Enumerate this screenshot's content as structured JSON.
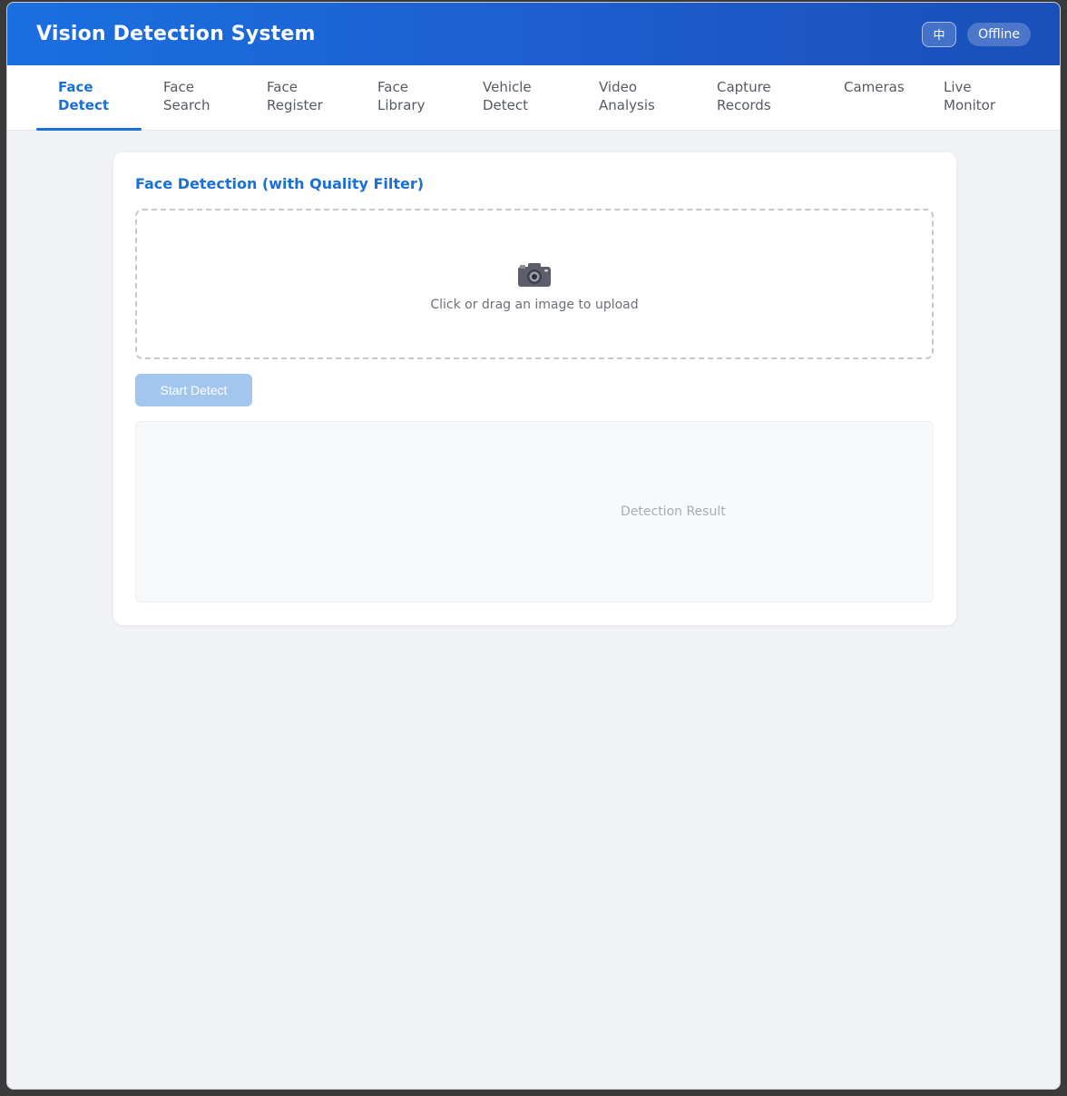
{
  "header": {
    "title": "Vision Detection System",
    "lang_button": "中",
    "status": "Offline"
  },
  "nav": {
    "tabs": [
      {
        "line1": "Face",
        "line2": "Detect",
        "active": true
      },
      {
        "line1": "Face",
        "line2": "Search",
        "active": false
      },
      {
        "line1": "Face",
        "line2": "Register",
        "active": false
      },
      {
        "line1": "Face",
        "line2": "Library",
        "active": false
      },
      {
        "line1": "Vehicle",
        "line2": "Detect",
        "active": false
      },
      {
        "line1": "Video",
        "line2": "Analysis",
        "active": false
      },
      {
        "line1": "Capture",
        "line2": "Records",
        "active": false
      },
      {
        "line1": "Cameras",
        "line2": "",
        "active": false
      },
      {
        "line1": "Live",
        "line2": "Monitor",
        "active": false
      }
    ]
  },
  "panel": {
    "title": "Face Detection (with Quality Filter)",
    "upload_icon": "camera-icon",
    "upload_text": "Click or drag an image to upload",
    "start_button": "Start Detect",
    "result_placeholder": "Detection Result"
  },
  "colors": {
    "accent": "#1a6fd8",
    "header_gradient_start": "#1a6fe0",
    "header_gradient_end": "#1a4fb8",
    "disabled_button": "#a3c6ef"
  }
}
